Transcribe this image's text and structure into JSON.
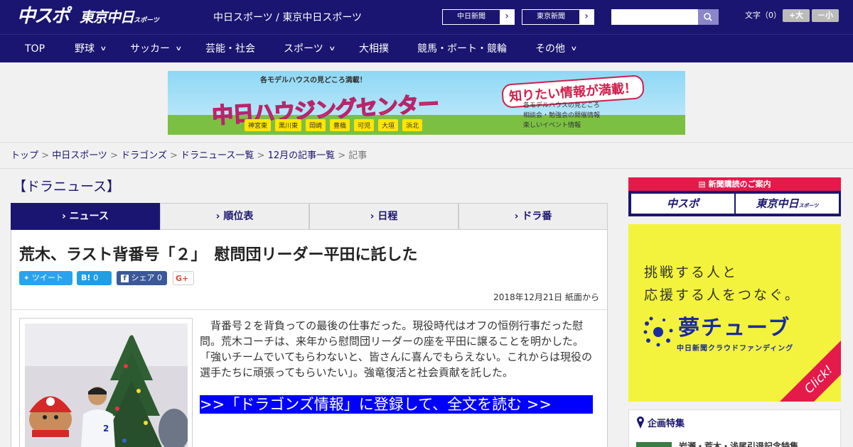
{
  "header": {
    "logo_chuspo": "中スポ",
    "logo_tokyo": "東京中日",
    "logo_tokyo_small": "スポーツ",
    "site_links": "中日スポーツ / 東京中日スポーツ",
    "paper_buttons": [
      "中日新聞",
      "東京新聞"
    ],
    "search": {
      "placeholder": ""
    },
    "font_size": {
      "label": "文字（0）",
      "larger": "+大",
      "smaller": "－小"
    }
  },
  "nav": {
    "items": [
      {
        "label": "TOP",
        "dropdown": false
      },
      {
        "label": "野球",
        "dropdown": true
      },
      {
        "label": "サッカー",
        "dropdown": true
      },
      {
        "label": "芸能・社会",
        "dropdown": false
      },
      {
        "label": "スポーツ",
        "dropdown": true
      },
      {
        "label": "大相撲",
        "dropdown": false
      },
      {
        "label": "競馬・ボート・競輪",
        "dropdown": false
      },
      {
        "label": "その他",
        "dropdown": true
      }
    ]
  },
  "banner": {
    "top": "各モデルハウスの見どころ満載！",
    "title": "中日ハウジングセンター",
    "right": "知りたい情報が満載！",
    "list": [
      "各モデルハウスの見どころ",
      "相談会・勉強会の開催情報",
      "楽しいイベント情報"
    ],
    "cities": [
      "神宮東",
      "黒川東",
      "岡崎",
      "豊橋",
      "可児",
      "大垣",
      "浜北"
    ]
  },
  "breadcrumb": {
    "links": [
      "トップ",
      "中日スポーツ",
      "ドラゴンズ",
      "ドラニュース一覧",
      "12月の記事一覧"
    ],
    "current": "記事"
  },
  "section_title": "【ドラニュース】",
  "tabs": [
    {
      "label": "ニュース",
      "active": true
    },
    {
      "label": "順位表",
      "active": false
    },
    {
      "label": "日程",
      "active": false
    },
    {
      "label": "ドラ番",
      "active": false
    }
  ],
  "article": {
    "headline": "荒木、ラスト背番号「２」　慰問団リーダー平田に託した",
    "share": {
      "tweet": "ツイート",
      "hatena_icon": "B!",
      "hatena_count": "0",
      "facebook": "シェア",
      "facebook_count": "0",
      "gplus": "G+"
    },
    "dateline": "2018年12月21日 紙面から",
    "body": "背番号２を背負っての最後の仕事だった。現役時代はオフの恒例行事だった慰問。荒木コーチは、来年から慰問団リーダーの座を平田に譲ることを明かした。「強いチームでいてもらわないと、皆さんに喜んでもらえない。これからは現役の選手たちに頑張ってもらいたい」。強竜復活と社会貢献を託した。",
    "cta": ">>「ドラゴンズ情報」に登録して、全文を読む >>",
    "photo_number": "2"
  },
  "sidebar": {
    "subscribe": {
      "header": "新聞購読のご案内",
      "buttons": [
        "中スポ",
        "東京中日"
      ],
      "button_small": "スポーツ"
    },
    "yume": {
      "line1": "挑戦する人と",
      "line2": "応援する人をつなぐ。",
      "brand": "夢チューブ",
      "sub": "中日新聞クラウドファンディング",
      "click": "Click!"
    },
    "special": {
      "title": "企画特集",
      "item": "岩瀬・荒木・浅尾引退記念特集"
    }
  },
  "colors": {
    "navy": "#1a1570",
    "red": "#e6194b",
    "cta_blue": "#0000ff",
    "yume_yellow": "#f3f33d"
  }
}
